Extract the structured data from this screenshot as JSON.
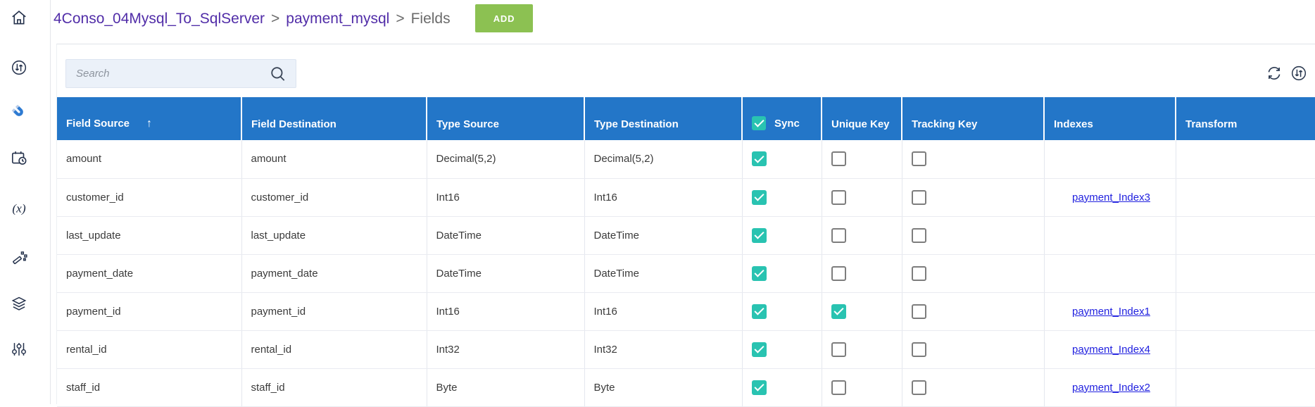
{
  "header": {
    "breadcrumb": [
      "4Conso_04Mysql_To_SqlServer",
      "payment_mysql",
      "Fields"
    ],
    "separator": ">",
    "add_button": "ADD"
  },
  "sidebar": {
    "items": [
      {
        "icon": "home-icon"
      },
      {
        "icon": "sync-circle-icon"
      },
      {
        "icon": "magnet-icon",
        "active": true
      },
      {
        "icon": "schedule-icon"
      },
      {
        "icon": "functions-icon",
        "glyph": "(x)"
      },
      {
        "icon": "magic-wand-icon"
      },
      {
        "icon": "layers-icon"
      },
      {
        "icon": "tune-icon"
      }
    ]
  },
  "toolbar": {
    "search_placeholder": "Search",
    "icons": [
      "refresh-icon",
      "import-export-icon"
    ]
  },
  "table": {
    "columns": [
      "Field Source",
      "Field Destination",
      "Type Source",
      "Type Destination",
      "Sync",
      "Unique Key",
      "Tracking Key",
      "Indexes",
      "Transform"
    ],
    "sort_column": "Field Source",
    "sort_direction": "ascending",
    "sort_arrow": "↑",
    "header_sync_checked": true,
    "rows": [
      {
        "field_source": "amount",
        "field_destination": "amount",
        "type_source": "Decimal(5,2)",
        "type_destination": "Decimal(5,2)",
        "sync": true,
        "unique_key": false,
        "tracking_key": false,
        "index": "",
        "transform": ""
      },
      {
        "field_source": "customer_id",
        "field_destination": "customer_id",
        "type_source": "Int16",
        "type_destination": "Int16",
        "sync": true,
        "unique_key": false,
        "tracking_key": false,
        "index": "payment_Index3",
        "transform": ""
      },
      {
        "field_source": "last_update",
        "field_destination": "last_update",
        "type_source": "DateTime",
        "type_destination": "DateTime",
        "sync": true,
        "unique_key": false,
        "tracking_key": false,
        "index": "",
        "transform": ""
      },
      {
        "field_source": "payment_date",
        "field_destination": "payment_date",
        "type_source": "DateTime",
        "type_destination": "DateTime",
        "sync": true,
        "unique_key": false,
        "tracking_key": false,
        "index": "",
        "transform": ""
      },
      {
        "field_source": "payment_id",
        "field_destination": "payment_id",
        "type_source": "Int16",
        "type_destination": "Int16",
        "sync": true,
        "unique_key": true,
        "tracking_key": false,
        "index": "payment_Index1",
        "transform": ""
      },
      {
        "field_source": "rental_id",
        "field_destination": "rental_id",
        "type_source": "Int32",
        "type_destination": "Int32",
        "sync": true,
        "unique_key": false,
        "tracking_key": false,
        "index": "payment_Index4",
        "transform": ""
      },
      {
        "field_source": "staff_id",
        "field_destination": "staff_id",
        "type_source": "Byte",
        "type_destination": "Byte",
        "sync": true,
        "unique_key": false,
        "tracking_key": false,
        "index": "payment_Index2",
        "transform": ""
      }
    ]
  },
  "colors": {
    "header_blue": "#2376C8",
    "checkbox_teal": "#29C3B1",
    "add_green": "#8CC152",
    "link_blue": "#2121DF",
    "breadcrumb_purple": "#512DA8"
  }
}
